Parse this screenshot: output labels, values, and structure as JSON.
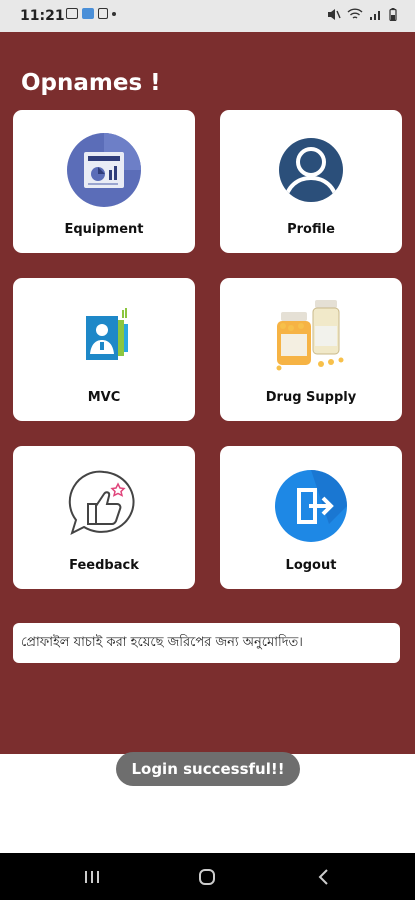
{
  "status_bar": {
    "time": "11:21",
    "icons": [
      "gallery-icon",
      "app-icon",
      "trash-icon",
      "dot-icon",
      "mute-icon",
      "wifi-icon",
      "signal-icon",
      "battery-icon"
    ]
  },
  "app": {
    "title": "Opnames !",
    "background_color": "#7b2e2e"
  },
  "grid": [
    {
      "label": "Equipment",
      "icon": "equipment-icon"
    },
    {
      "label": "Profile",
      "icon": "profile-icon"
    },
    {
      "label": "MVC",
      "icon": "mvc-icon"
    },
    {
      "label": "Drug Supply",
      "icon": "drug-supply-icon"
    },
    {
      "label": "Feedback",
      "icon": "feedback-icon"
    },
    {
      "label": "Logout",
      "icon": "logout-icon"
    }
  ],
  "message": "প্রোফাইল যাচাই করা হয়েছে জরিপের জন্য অনুমোদিত।",
  "toast": "Login successful!!",
  "nav_bar": {
    "buttons": [
      "recents-icon",
      "home-icon",
      "back-icon"
    ]
  }
}
